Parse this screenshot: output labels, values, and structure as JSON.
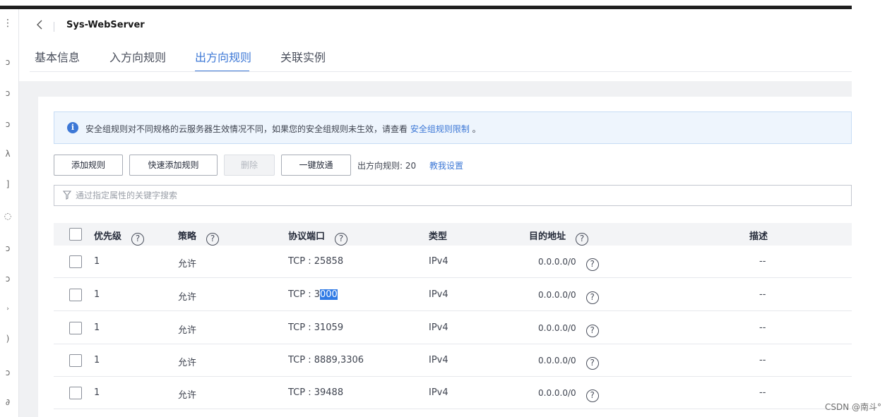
{
  "header": {
    "title": "Sys-WebServer",
    "back_icon": "chevron-left-icon"
  },
  "tabs": [
    {
      "label": "基本信息",
      "active": false
    },
    {
      "label": "入方向规则",
      "active": false
    },
    {
      "label": "出方向规则",
      "active": true
    },
    {
      "label": "关联实例",
      "active": false
    }
  ],
  "notice": {
    "text": "安全组规则对不同规格的云服务器生效情况不同，如果您的安全组规则未生效，请查看 ",
    "link": "安全组规则限制",
    "suffix": " 。"
  },
  "toolbar": {
    "add_rule": "添加规则",
    "quick_add_rule": "快速添加规则",
    "delete": "删除",
    "one_click_allow": "一键放通",
    "rule_count": "出方向规则: 20",
    "help_link": "教我设置"
  },
  "search": {
    "placeholder": "通过指定属性的关键字搜索",
    "value": ""
  },
  "table": {
    "headers": {
      "priority": "优先级",
      "policy": "策略",
      "protocol_port": "协议端口",
      "type": "类型",
      "destination": "目的地址",
      "description": "描述"
    },
    "rows": [
      {
        "priority": "1",
        "policy": "允许",
        "port": "TCP : 25858",
        "port_prefix": "",
        "port_selected": "",
        "type": "IPv4",
        "destination": "0.0.0.0/0",
        "description": "--"
      },
      {
        "priority": "1",
        "policy": "允许",
        "port": "",
        "port_prefix": "TCP : 3",
        "port_selected": "000",
        "type": "IPv4",
        "destination": "0.0.0.0/0",
        "description": "--"
      },
      {
        "priority": "1",
        "policy": "允许",
        "port": "TCP : 31059",
        "port_prefix": "",
        "port_selected": "",
        "type": "IPv4",
        "destination": "0.0.0.0/0",
        "description": "--"
      },
      {
        "priority": "1",
        "policy": "允许",
        "port": "TCP : 8889,3306",
        "port_prefix": "",
        "port_selected": "",
        "type": "IPv4",
        "destination": "0.0.0.0/0",
        "description": "--"
      },
      {
        "priority": "1",
        "policy": "允许",
        "port": "TCP : 39488",
        "port_prefix": "",
        "port_selected": "",
        "type": "IPv4",
        "destination": "0.0.0.0/0",
        "description": "--"
      }
    ]
  },
  "help_icon_glyph": "?",
  "watermark": "CSDN @南斗°",
  "colors": {
    "accent": "#3d78d6",
    "notice_bg": "#eef5fd",
    "selection": "#2f7ae5",
    "page_bg": "#f0f1f3"
  }
}
